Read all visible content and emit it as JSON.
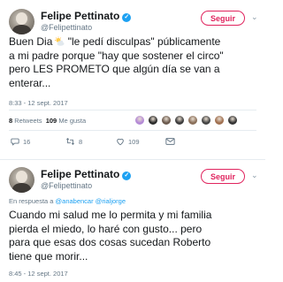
{
  "tweet1": {
    "author": "Felipe Pettinato",
    "handle": "@Felipettinato",
    "follow_label": "Seguir",
    "text_lines": [
      "Buen Dia",
      "\"le pedí disculpas\" públicamente",
      "a mi padre porque \"hay que sostener el circo\"",
      "pero LES PROMETO que algún día se van a",
      "enterar..."
    ],
    "timestamp": "8:33 - 12 sept. 2017",
    "retweets_count": "8",
    "retweets_label": "Retweets",
    "likes_count": "109",
    "likes_label": "Me gusta",
    "replies": "16",
    "retweet_action": "8",
    "like_action": "109",
    "avatar_colors": [
      "#b48ad6",
      "#2b2b2b",
      "#6b5a4e",
      "#3c3c3c",
      "#8a6f5a",
      "#444444",
      "#a07050",
      "#333333"
    ]
  },
  "tweet2": {
    "author": "Felipe Pettinato",
    "handle": "@Felipettinato",
    "follow_label": "Seguir",
    "reply_prefix": "En respuesta a",
    "reply_user1": "@anabencar",
    "reply_user2": "@rialjorge",
    "text_lines": [
      "Cuando mi salud me lo permita y mi familia",
      "pierda el miedo, lo haré con gusto... pero",
      "para que esas dos cosas sucedan Roberto",
      "tiene que morir..."
    ],
    "timestamp": "8:45 - 12 sept. 2017"
  },
  "colors": {
    "verified": "#1da1f2",
    "follow": "#e0245e",
    "secondary_text": "#657786"
  }
}
